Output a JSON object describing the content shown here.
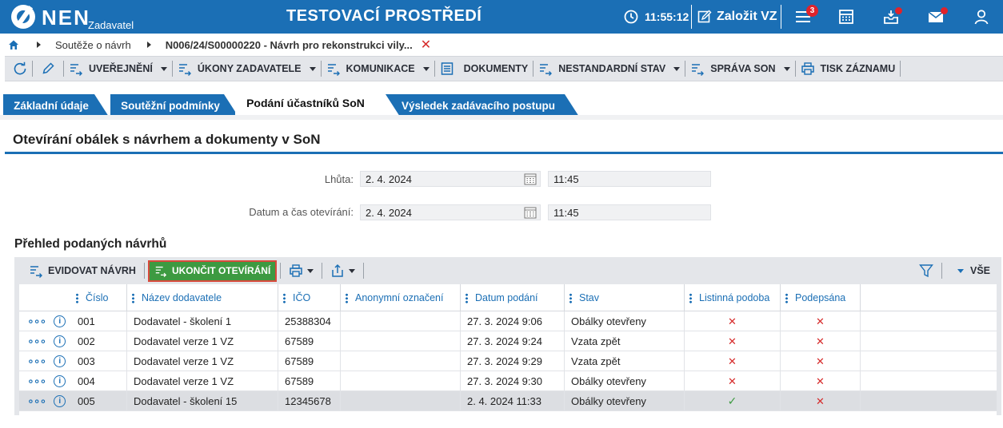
{
  "header": {
    "logo": "NEN",
    "logo_sub": "Zadavatel",
    "env_title": "TESTOVACÍ PROSTŘEDÍ",
    "time": "11:55:12",
    "create_label": "Založit VZ",
    "notification_count": "3",
    "accent_color": "#1b6fb5",
    "alert_color": "#e0232b"
  },
  "breadcrumb": {
    "item1": "Soutěže o návrh",
    "current": "N006/24/S00000220 - Návrh pro rekonstrukci vily...",
    "close": "✕"
  },
  "toolbar": {
    "uverejneni": "UVEŘEJNĚNÍ",
    "ukony": "ÚKONY ZADAVATELE",
    "komunikace": "KOMUNIKACE",
    "dokumenty": "DOKUMENTY",
    "nestandardni": "NESTANDARDNÍ STAV",
    "sprava": "SPRÁVA SON",
    "tisk": "TISK ZÁZNAMU"
  },
  "tabs": [
    "Základní údaje",
    "Soutěžní podmínky",
    "Podání účastníků SoN",
    "Výsledek zadávacího postupu"
  ],
  "section": {
    "title": "Otevírání obálek s návrhem a dokumenty v SoN",
    "lhuta_label": "Lhůta:",
    "lhuta_date": "2. 4. 2024",
    "lhuta_time": "11:45",
    "otevirani_label": "Datum a čas otevírání:",
    "otevirani_date": "2. 4. 2024",
    "otevirani_time": "11:45"
  },
  "list": {
    "title": "Přehled podaných návrhů",
    "evidovat": "EVIDOVAT NÁVRH",
    "ukoncit": "UKONČIT OTEVÍRÁNÍ",
    "vse": "VŠE",
    "columns": [
      "Číslo",
      "Název dodavatele",
      "IČO",
      "Anonymní označení",
      "Datum podání",
      "Stav",
      "Listinná podoba",
      "Podepsána"
    ],
    "rows": [
      {
        "cislo": "001",
        "nazev": "Dodavatel - školení 1",
        "ico": "25388304",
        "anon": "",
        "datum": "27. 3. 2024 9:06",
        "stav": "Obálky otevřeny",
        "listinna": "no",
        "podepsana": "no"
      },
      {
        "cislo": "002",
        "nazev": "Dodavatel verze 1 VZ",
        "ico": "67589",
        "anon": "",
        "datum": "27. 3. 2024 9:24",
        "stav": "Vzata zpět",
        "listinna": "no",
        "podepsana": "no"
      },
      {
        "cislo": "003",
        "nazev": "Dodavatel verze 1 VZ",
        "ico": "67589",
        "anon": "",
        "datum": "27. 3. 2024 9:29",
        "stav": "Vzata zpět",
        "listinna": "no",
        "podepsana": "no"
      },
      {
        "cislo": "004",
        "nazev": "Dodavatel verze 1 VZ",
        "ico": "67589",
        "anon": "",
        "datum": "27. 3. 2024 9:30",
        "stav": "Obálky otevřeny",
        "listinna": "no",
        "podepsana": "no"
      },
      {
        "cislo": "005",
        "nazev": "Dodavatel - školení 15",
        "ico": "12345678",
        "anon": "",
        "datum": "2. 4. 2024 11:33",
        "stav": "Obálky otevřeny",
        "listinna": "yes",
        "podepsana": "no"
      }
    ],
    "selected_row": 4
  }
}
